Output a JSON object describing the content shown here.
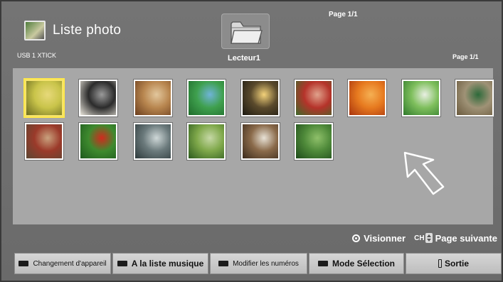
{
  "header": {
    "app_title": "Liste photo",
    "device": "USB 1 XTICK",
    "page_top": "Page 1/1",
    "page_right": "Page 1/1",
    "drive_label": "Lecteur1",
    "drive_icon": "folder-icon"
  },
  "thumbnails": [
    {
      "name": "photo-butterfly",
      "colors": [
        "#6a6a1f",
        "#c9c44a",
        "#e7d97a"
      ]
    },
    {
      "name": "photo-horse-rider",
      "colors": [
        "#eae6dc",
        "#2b2b2b",
        "#9a9a9a"
      ]
    },
    {
      "name": "photo-wooden-corridor",
      "colors": [
        "#6b3e1e",
        "#b8864f",
        "#e2c79d"
      ]
    },
    {
      "name": "photo-blue-flowers",
      "colors": [
        "#1f6b2b",
        "#3fa04e",
        "#6fb4d8"
      ]
    },
    {
      "name": "photo-sunset",
      "colors": [
        "#1d1a12",
        "#5a4a2c",
        "#f3d27a"
      ]
    },
    {
      "name": "photo-red-tree",
      "colors": [
        "#3c6a2b",
        "#b5332a",
        "#e0a28c"
      ]
    },
    {
      "name": "photo-oranges",
      "colors": [
        "#a8340e",
        "#e77a1f",
        "#f5b053"
      ]
    },
    {
      "name": "photo-dandelion",
      "colors": [
        "#2f7a2b",
        "#7fbf5d",
        "#e9efe3"
      ]
    },
    {
      "name": "photo-stone-garden",
      "colors": [
        "#6a5a3e",
        "#9f9276",
        "#2d6a3a"
      ]
    },
    {
      "name": "photo-rose-hips",
      "colors": [
        "#5b4733",
        "#9b3a2a",
        "#c9a27e"
      ]
    },
    {
      "name": "photo-red-rose",
      "colors": [
        "#1e5a1e",
        "#3e8a2e",
        "#d12a1e"
      ]
    },
    {
      "name": "photo-stone-basin",
      "colors": [
        "#2e3a3c",
        "#6b7a7c",
        "#cfd8d8"
      ]
    },
    {
      "name": "photo-garden-path",
      "colors": [
        "#2c5a1e",
        "#7fa84a",
        "#c6d8a6"
      ]
    },
    {
      "name": "photo-temple-hall",
      "colors": [
        "#3a2a1c",
        "#8a6a4a",
        "#e8e2d6"
      ]
    },
    {
      "name": "photo-bamboo",
      "colors": [
        "#1e4a1a",
        "#4f8a3a",
        "#8fc06a"
      ]
    }
  ],
  "hints": {
    "ok_icon": "ok-button-icon",
    "visionner": "Visionner",
    "ch_label": "CH",
    "page_suivante": "Page suivante"
  },
  "buttons": [
    {
      "label": "Changement d'appareil",
      "swatch": "#1b1b1b"
    },
    {
      "label": "A la liste musique",
      "swatch": "#1b1b1b"
    },
    {
      "label": "Modifier les numéros",
      "swatch": "#1b1b1b"
    },
    {
      "label": "Mode Sélection",
      "swatch": "#1b1b1b"
    },
    {
      "label": "Sortie",
      "swatch": "exit-icon"
    }
  ],
  "colors": {
    "background": "#6f6f6f",
    "grid_panel": "#a7a7a7",
    "selection": "#ffe84a",
    "button": "#cfcfcf"
  }
}
